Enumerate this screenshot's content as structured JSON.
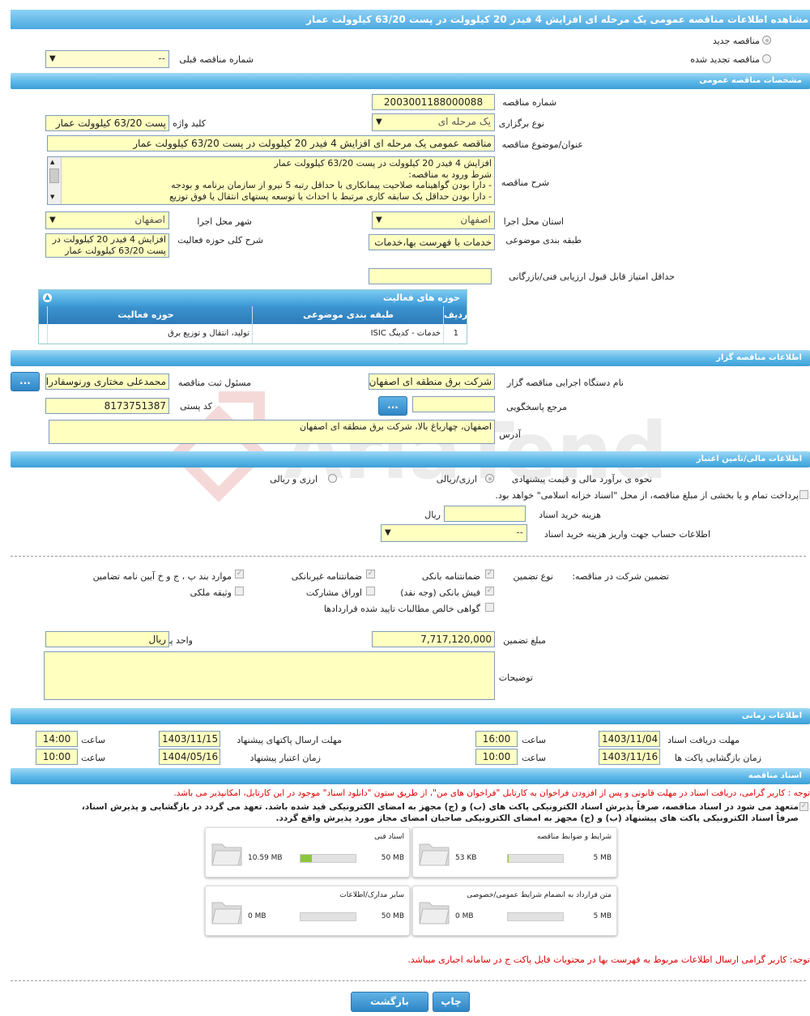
{
  "header": {
    "title": "مشاهده اطلاعات مناقصه عمومی یک مرحله ای افزایش 4 فیدر 20 کیلوولت در پست 63/20 کیلوولت عمار"
  },
  "tender_type": {
    "new_label": "مناقصه جدید",
    "renewed_label": "مناقصه تجدید شده",
    "prev_number_label": "شماره مناقصه قبلی",
    "prev_number_value": "--"
  },
  "general": {
    "section_title": "مشخصات مناقصه عمومی",
    "number_label": "شماره مناقصه",
    "number_value": "2003001188000088",
    "holding_type_label": "نوع برگزاری",
    "holding_type_value": "یک مرحله ای",
    "keyword_label": "کلید واژه",
    "keyword_value": "پست 63/20 کیلوولت عمار",
    "subject_label": "عنوان/موضوع مناقصه",
    "subject_value": "مناقصه عمومی یک مرحله ای افزایش 4 فیدر 20 کیلوولت در پست 63/20 کیلوولت عمار",
    "description_label": "شرح مناقصه",
    "description_lines": [
      "افزایش 4 فیدر 20 کیلوولت در پست 63/20 کیلوولت عمار",
      "شرط ورود به مناقصه:",
      "- دارا بودن گواهینامه صلاحیت پیمانکاری با حداقل رتبه 5 نیرو از سازمان برنامه و بودجه",
      "- دارا بودن حداقل یک سابقه کاری مرتبط با احداث یا توسعه پستهای انتقال یا فوق توزیع"
    ],
    "province_label": "استان محل اجرا",
    "province_value": "اصفهان",
    "city_label": "شهر محل اجرا",
    "city_value": "اصفهان",
    "category_label": "طبقه بندی موضوعی",
    "category_value": "خدمات با فهرست بها،خدمات",
    "activity_desc_label": "شرح کلی حوزه فعالیت",
    "activity_desc_lines": [
      "افزایش 4 فیدر 20 کیلوولت در",
      "پست 63/20 کیلوولت عمار"
    ],
    "min_score_label": "حداقل امتیاز قابل قبول ارزیابی فنی/بازرگانی"
  },
  "activities": {
    "title": "حوزه های فعالیت",
    "col_row": "ردیف",
    "col_category": "طبقه بندی موضوعی",
    "col_field": "حوزه فعالیت",
    "rows": [
      {
        "row": "1",
        "category": "خدمات - کدینگ ISIC",
        "field": "تولید، انتقال و توزیع برق"
      }
    ]
  },
  "organizer": {
    "section_title": "اطلاعات مناقصه گزار",
    "org_label": "نام دستگاه اجرایی مناقصه گزار",
    "org_value": "شرکت برق منطقه ای اصفهان",
    "registrar_label": "مسئول ثبت مناقصه",
    "registrar_value": "محمدعلی مختاری ورنوسفادرانی",
    "ref_label": "مرجع پاسخگویی",
    "postal_label": "کد پستی",
    "postal_value": "8173751387",
    "address_label": "آدرس",
    "address_value": "اصفهان، چهارباغ بالا، شرکت برق منطقه ای اصفهان",
    "dots_label": "..."
  },
  "finance": {
    "section_title": "اطلاعات مالی/تامین اعتبار",
    "estimate_label": "نحوه ی برآورد مالی و قیمت پیشنهادی",
    "opt_rial": "ارزی/ریالی",
    "opt_currency": "ارزی و ریالی",
    "treasury_text": "پرداخت تمام و یا بخشی از مبلغ مناقصه، از محل \"اسناد خزانه اسلامی\" خواهد بود.",
    "doc_fee_label": "هزینه خرید اسناد",
    "doc_fee_unit": "ریال",
    "account_label": "اطلاعات حساب جهت واریز هزینه خرید اسناد",
    "account_value": "--"
  },
  "guarantee": {
    "participation_label": "تضمین شرکت در مناقصه:",
    "type_label": "نوع تضمین",
    "opt_bank": "ضمانتنامه بانکی",
    "opt_nonbank": "ضمانتنامه غیربانکی",
    "opt_rules": "موارد بند پ ، ج و خ آیین نامه تضامین",
    "opt_receipt": "فیش بانکی (وجه نقد)",
    "opt_bonds": "اوراق مشارکت",
    "opt_property": "وثیقه ملکی",
    "opt_claims": "گواهی خالص مطالبات تایید شده قراردادها",
    "amount_label": "مبلغ تضمین",
    "amount_value": "7,717,120,000",
    "currency_label": "واحد پول",
    "currency_value": "ریال",
    "notes_label": "توضیحات"
  },
  "timing": {
    "section_title": "اطلاعات زمانی",
    "receive_label": "مهلت دریافت اسناد",
    "receive_date": "1403/11/04",
    "receive_time": "16:00",
    "send_label": "مهلت ارسال پاکتهای پیشنهاد",
    "send_date": "1403/11/15",
    "send_time": "14:00",
    "open_label": "زمان بازگشایی پاکت ها",
    "open_date": "1403/11/16",
    "open_time": "10:00",
    "valid_label": "زمان اعتبار پیشنهاد",
    "valid_date": "1404/05/16",
    "valid_time": "10:00",
    "time_label": "ساعت"
  },
  "documents": {
    "section_title": "اسناد مناقصه",
    "notice": "توجه : کاربر گرامی، دریافت اسناد در مهلت قانونی و پس از افزودن فراخوان به کارتابل \"فراخوان های من\"، از طریق ستون \"دانلود اسناد\" موجود در این کارتابل، امکانپذیر می باشد.",
    "commit_line1": "متعهد می شود در اسناد مناقصه، صرفاً پذیرش اسناد الکترونیکی پاکت های (ب) و (ج) مجهز به امضای الکترونیکی قید شده باشد. تعهد می گردد در بازگشایی و پذیرش اسناد،",
    "commit_line2": "صرفاً اسناد الکترونیکی پاکت های پیشنهاد (ب) و (ج) مجهز به امضای الکترونیکی صاحبان امضای مجاز مورد پذیرش واقع گردد.",
    "cards": [
      {
        "title": "شرایط و ضوابط مناقصه",
        "used": "53 KB",
        "max": "5 MB",
        "fill": 0.01
      },
      {
        "title": "اسناد فنی",
        "used": "10.59 MB",
        "max": "50 MB",
        "fill": 0.21
      },
      {
        "title": "متن قرارداد به انضمام شرایط عمومی/خصوصی",
        "used": "0 MB",
        "max": "5 MB",
        "fill": 0
      },
      {
        "title": "سایر مدارک/اطلاعات",
        "used": "0 MB",
        "max": "50 MB",
        "fill": 0
      }
    ],
    "bottom_notice": "توجه: کاربر گرامی ارسال اطلاعات مربوط به فهرست بها در محتویات فایل پاکت ج در سامانه اجباری میباشد."
  },
  "footer": {
    "print_label": "چاپ",
    "back_label": "بازگشت"
  },
  "watermark": {
    "text": "AriaTender.neT"
  },
  "colors": {
    "accent": "#3d9fd6",
    "field_bg": "#ffffc0",
    "notice_red": "#d00000",
    "progress_green": "#8cc63f"
  }
}
